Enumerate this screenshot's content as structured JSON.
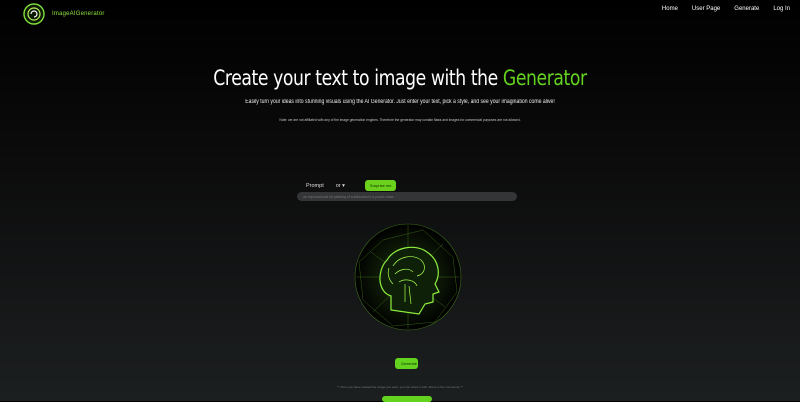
{
  "brand": {
    "name": "ImageAIGenerator",
    "accent": "#63d31f"
  },
  "nav": {
    "items": [
      "Home",
      "User Page",
      "Generate",
      "Log In"
    ]
  },
  "hero": {
    "title_prefix": "Create your text to image with the ",
    "title_accent": "Generator",
    "subtitle": "Easily turn your ideas into stunning visuals using the AI Generator. Just enter your text, pick a style, and see your imagination come alive!",
    "disclaimer": "Note: we are not affiliated with any of the image generation engines. Therefore the generator may contain flaws and images for commercial purposes are not allowed."
  },
  "prompt": {
    "label": "Prompt",
    "select_value": "or",
    "surprise_label": "Surprise me",
    "placeholder": "an impressionist oil painting of sunflowers in a purple vase..."
  },
  "generate": {
    "label": "Generate"
  },
  "footnote": "** Once you have created the image you want, you can share it with others in the community **"
}
